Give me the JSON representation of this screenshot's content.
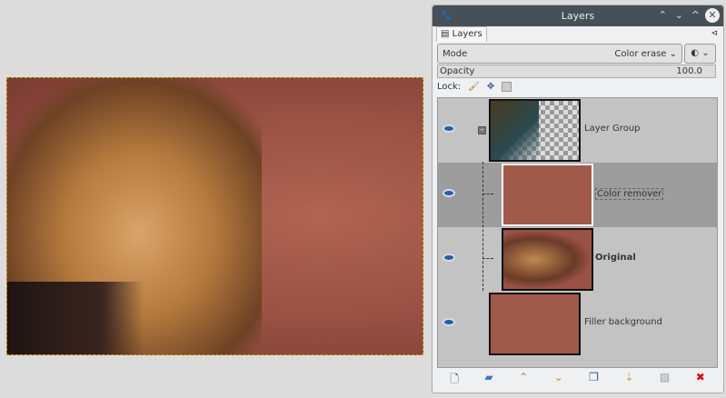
{
  "window": {
    "title": "Layers",
    "tab": "Layers"
  },
  "mode": {
    "label": "Mode",
    "value": "Color erase"
  },
  "opacity": {
    "label": "Opacity",
    "value": "100.0"
  },
  "lock": {
    "label": "Lock:"
  },
  "layers": [
    {
      "name": "Layer Group"
    },
    {
      "name": "Color remover"
    },
    {
      "name": "Original"
    },
    {
      "name": "Filler background"
    }
  ],
  "colors": {
    "layer_fill": "#a05a4a",
    "accent": "#475057"
  }
}
